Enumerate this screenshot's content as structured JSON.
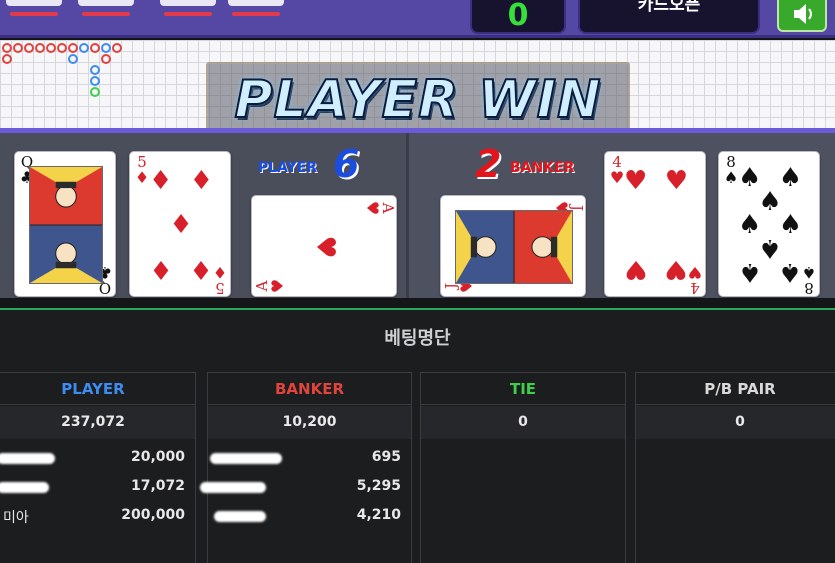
{
  "header": {
    "count": "0",
    "card_open_label": "카드오픈",
    "sound_icon": "speaker-icon"
  },
  "result": {
    "banner": "PLAYER WIN"
  },
  "player": {
    "label": "PLAYER",
    "score": "6",
    "cards": [
      {
        "rank": "Q",
        "suit": "♣",
        "color": "#111111"
      },
      {
        "rank": "5",
        "suit": "♦",
        "color": "#d8202a"
      },
      {
        "rank": "A",
        "suit": "♥",
        "color": "#d8202a"
      }
    ]
  },
  "banker": {
    "label": "BANKER",
    "score": "2",
    "cards": [
      {
        "rank": "J",
        "suit": "♥",
        "color": "#d8202a"
      },
      {
        "rank": "4",
        "suit": "♥",
        "color": "#d8202a"
      },
      {
        "rank": "8",
        "suit": "♠",
        "color": "#111111"
      }
    ]
  },
  "colors": {
    "player": "#3d8cf0",
    "banker": "#e0443c",
    "tie": "#3fcf4b",
    "pair": "#d9d9d9",
    "score_player": "#1b4de0",
    "score_banker": "#e4141c"
  },
  "betting": {
    "title": "베팅명단",
    "columns": [
      {
        "header": "PLAYER",
        "total": "237,072",
        "rows": [
          {
            "name": "",
            "amount": "20,000"
          },
          {
            "name": "",
            "amount": "17,072"
          },
          {
            "name": "미아",
            "amount": "200,000"
          }
        ]
      },
      {
        "header": "BANKER",
        "total": "10,200",
        "rows": [
          {
            "name": "",
            "amount": "695"
          },
          {
            "name": "",
            "amount": "5,295"
          },
          {
            "name": "",
            "amount": "4,210"
          }
        ]
      },
      {
        "header": "TIE",
        "total": "0",
        "rows": []
      },
      {
        "header": "P/B PAIR",
        "total": "0",
        "rows": []
      }
    ]
  }
}
